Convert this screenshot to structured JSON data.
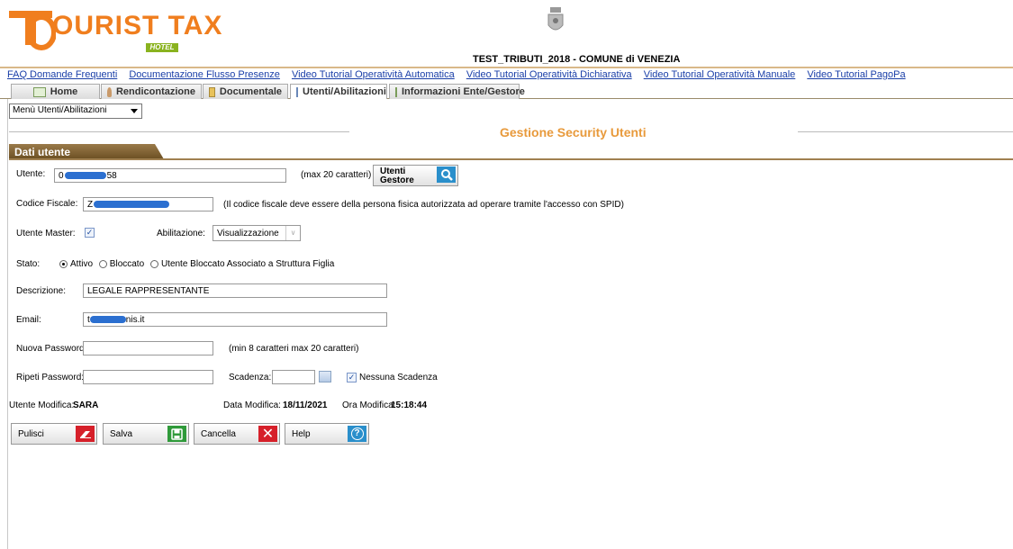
{
  "logo": {
    "text": "OURIST TAX",
    "sub": "HOTEL"
  },
  "ente_title": "TEST_TRIBUTI_2018 - COMUNE di VENEZIA",
  "links": [
    "FAQ Domande Frequenti",
    "Documentazione Flusso Presenze",
    "Video Tutorial Operatività Automatica",
    "Video Tutorial Operatività Dichiarativa",
    "Video Tutorial Operatività Manuale",
    "Video Tutorial PagoPa"
  ],
  "tabs": [
    {
      "label": "Home",
      "icon": "home-icon"
    },
    {
      "label": "Rendicontazione",
      "icon": "user-icon"
    },
    {
      "label": "Documentale",
      "icon": "folder-icon"
    },
    {
      "label": "Utenti/Abilitazioni",
      "icon": "id-card-icon",
      "active": true
    },
    {
      "label": "Informazioni Ente/Gestore",
      "icon": "info-list-icon"
    }
  ],
  "menu_select": "Menù Utenti/Abilitazioni",
  "page_title": "Gestione Security Utenti",
  "section": "Dati utente",
  "form": {
    "utente_label": "Utente:",
    "utente_value_start": "0",
    "utente_value_end": "58",
    "utente_hint": "(max 20 caratteri)",
    "utenti_gestore_btn": "Utenti Gestore",
    "cf_label": "Codice Fiscale:",
    "cf_value_start": "Z",
    "cf_hint": "(Il codice fiscale deve essere della persona fisica autorizzata ad operare tramite l'accesso con SPID)",
    "master_label": "Utente Master:",
    "abilitazione_label": "Abilitazione:",
    "abilitazione_value": "Visualizzazione",
    "stato_label": "Stato:",
    "stato_options": [
      "Attivo",
      "Bloccato",
      "Utente Bloccato Associato a Struttura Figlia"
    ],
    "descrizione_label": "Descrizione:",
    "descrizione_value": "LEGALE RAPPRESENTANTE",
    "email_label": "Email:",
    "email_value_start": "t",
    "email_value_end": "nis.it",
    "nuova_password_label": "Nuova Password:",
    "password_hint": "(min 8 caratteri max 20 caratteri)",
    "ripeti_password_label": "Ripeti Password:",
    "scadenza_label": "Scadenza:",
    "nessuna_scadenza_label": "Nessuna Scadenza",
    "utente_modifica_label": "Utente Modifica:",
    "utente_modifica_value": "SARA",
    "data_modifica_label": "Data Modifica:",
    "data_modifica_value": "18/11/2021",
    "ora_modifica_label": "Ora Modifica:",
    "ora_modifica_value": "15:18:44"
  },
  "buttons": {
    "pulisci": "Pulisci",
    "salva": "Salva",
    "cancella": "Cancella",
    "help": "Help"
  },
  "colors": {
    "brand_orange": "#f07e1e",
    "brand_green": "#8ab31f",
    "section_brown": "#8a6a3a",
    "link_blue": "#1a3fa8"
  }
}
